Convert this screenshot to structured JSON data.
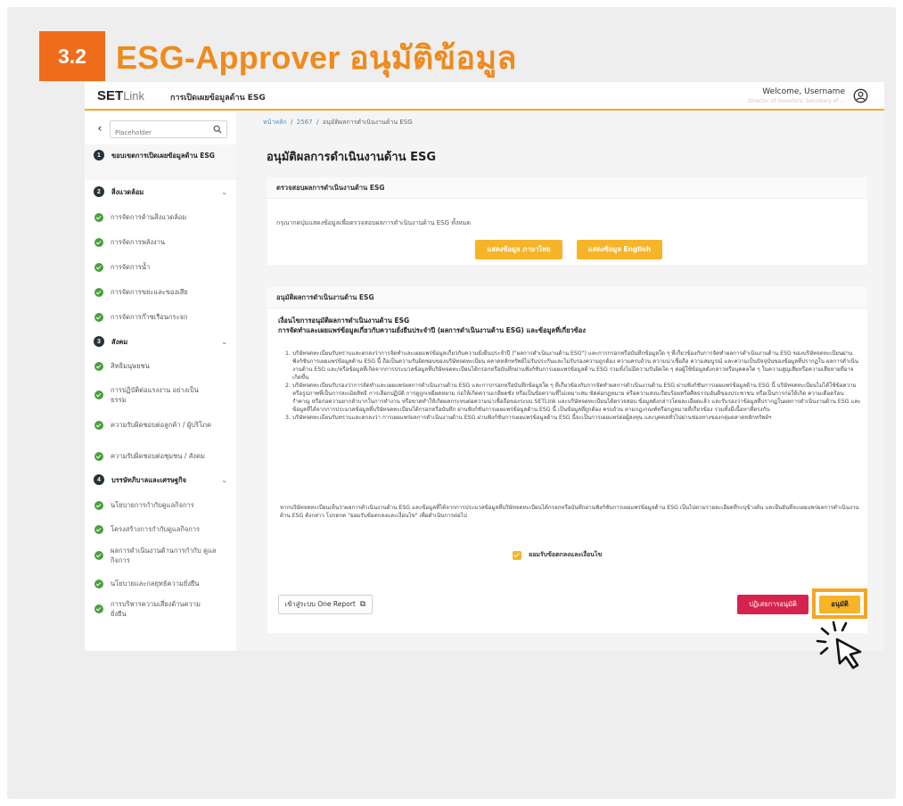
{
  "step": {
    "number": "3.2",
    "title": "ESG-Approver อนุมัติข้อมูล"
  },
  "header": {
    "logo_main": "SET",
    "logo_sub": "Link",
    "app_title": "การเปิดเผยข้อมูลด้าน ESG",
    "welcome": "Welcome, Username",
    "role": "Director of Investors, Secretary of ...",
    "user_icon": "user-circle-icon"
  },
  "sidebar": {
    "search_placeholder": "Placeholder",
    "items": [
      {
        "type": "section",
        "num": "1",
        "label": "ขอบเขตการเปิดเผยข้อมูลด้าน ESG"
      },
      {
        "type": "section",
        "num": "2",
        "label": "สิ่งแวดล้อม"
      },
      {
        "type": "item",
        "label": "การจัดการด้านสิ่งแวดล้อม"
      },
      {
        "type": "item",
        "label": "การจัดการพลังงาน"
      },
      {
        "type": "item",
        "label": "การจัดการน้ำ"
      },
      {
        "type": "item",
        "label": "การจัดการขยะและของเสีย"
      },
      {
        "type": "item",
        "label": "การจัดการก๊าซเรือนกระจก"
      },
      {
        "type": "section",
        "num": "3",
        "label": "สังคม"
      },
      {
        "type": "item",
        "label": "สิทธิมนุษยชน"
      },
      {
        "type": "item",
        "label": "การปฏิบัติต่อแรงงาน อย่างเป็นธรรม"
      },
      {
        "type": "item",
        "label": "ความรับผิดชอบต่อลูกค้า / ผู้บริโภค"
      },
      {
        "type": "item",
        "label": "ความรับผิดชอบต่อชุมชน / สังคม"
      },
      {
        "type": "section",
        "num": "4",
        "label": "บรรษัทภิบาลและเศรษฐกิจ"
      },
      {
        "type": "item",
        "label": "นโยบายการกำกับดูแลกิจการ"
      },
      {
        "type": "item",
        "label": "โครงสร้างการกำกับดูแลกิจการ"
      },
      {
        "type": "item",
        "label": "ผลการดำเนินงานด้านการกำกับ ดูแลกิจการ"
      },
      {
        "type": "item",
        "label": "นโยบายและกลยุทธ์ความยั่งยืน"
      },
      {
        "type": "item",
        "label": "การบริหารความเสี่ยงด้านความ ยั่งยืน"
      }
    ]
  },
  "breadcrumb": {
    "home": "หน้าหลัก",
    "year": "2567",
    "current": "อนุมัติผลการดำเนินงานด้าน ESG",
    "sep": "/"
  },
  "page_title": "อนุมัติผลการดำเนินงานด้าน ESG",
  "review": {
    "heading": "ตรวจสอบผลการดำเนินงานด้าน ESG",
    "description": "กรุณากดปุ่มแสดงข้อมูลเพื่อตรวจสอบผลการดำเนินงานด้าน ESG ทั้งหมด",
    "btn_thai": "แสดงข้อมูล ภาษาไทย",
    "btn_english": "แสดงข้อมูล English"
  },
  "approval": {
    "heading": "อนุมัติผลการดำเนินงานด้าน ESG",
    "cond_title": "เงื่อนไขการอนุมัติผลการดำเนินงานด้าน ESG",
    "cond_subtitle": "การจัดทำและเผยแพร่ข้อมูลเกี่ยวกับความยั่งยืนประจำปี (ผลการดำเนินงานด้าน ESG) และข้อมูลที่เกี่ยวข้อง",
    "terms": [
      {
        "n": "1.",
        "text": "บริษัทจดทะเบียนรับทราบและตกลงว่าการจัดทำและเผยแพร่ข้อมูลเกี่ยวกับความยั่งยืนประจำปี (\"ผลการดำเนินงานด้าน ESG\") และการกรอกหรือบันทึกข้อมูลใด ๆ ที่เกี่ยวข้องกับการจัดทำผลการดำเนินงานด้าน ESG ของบริษัทจดทะเบียนผ่านฟังก์ชันการเผยแพร่ข้อมูลด้าน ESG นี้ ถือเป็นความรับผิดชอบของบริษัทจดทะเบียน ตลาดหลักทรัพย์ไม่รับประกันและไม่รับรองความถูกต้อง ความครบถ้วน ความน่าเชื่อถือ ความสมบูรณ์ และความเป็นปัจจุบันของข้อมูลที่ปรากฏใน ผลการดำเนินงานด้าน ESG และ/หรือข้อมูลที่เกิดจากการประมวลข้อมูลที่บริษัทจดทะเบียนได้กรอกหรือบันทึกผ่านฟังก์ชันการเผยแพร่ข้อมูลด้าน ESG รวมทั้งไม่มีความรับผิดใด ๆ ต่อผู้ใช้ข้อมูลดังกล่าวหรือบุคคลใด ๆ ในความสูญเสียหรือความเสียหายที่อาจเกิดขึ้น"
      },
      {
        "n": "2.",
        "text": "บริษัทจดทะเบียนรับรองว่าการจัดทำและเผยแพร่ผลการดำเนินงานด้าน ESG และการกรอกหรือบันทึกข้อมูลใด ๆ ที่เกี่ยวข้องกับการจัดทำผลการดำเนินงานด้าน ESG ผ่านฟังก์ชันการเผยแพร่ข้อมูลด้าน ESG นี้ บริษัทจดทะเบียนไม่ได้ใช้ข้อความหรือรูปภาพที่เป็นการละเมิดสิทธิ การเลือกปฏิบัติ การดูถูกเหยียดหยาม ก่อให้เกิดความเกลียดชัง หรือเป็นข้อความที่ไม่เหมาะสม ขัดต่อกฎหมาย หรือความสงบเรียบร้อยหรือศีลธรรมอันดีของประชาชน หรือเป็นการก่อให้เกิด ความเดือดร้อนรำคาญ หรือก่อความยากลำบากในการทำงาน หรือขาดทำให้เกิดผลกระทบต่อความน่าเชื่อถือของระบบ SETLink และบริษัทจดทะเบียนได้ตรวจสอบ ข้อมูลดังกล่าวโดยละเอียดแล้ว และรับรองว่าข้อมูลที่ปรากฏในผลการดำเนินงานด้าน ESG และข้อมูลที่ได้จากการประมวลข้อมูลที่บริษัทจดทะเบียนได้กรอกหรือบันทึก ผ่านฟังก์ชันการเผยแพร่ข้อมูลด้าน ESG นี้ เป็นข้อมูลที่ถูกต้อง ครบถ้วน ตามกฎเกณฑ์หรือกฎหมายที่เกี่ยวข้อง รวมทั้งมีเนื้อหาที่ตรงกัน"
      },
      {
        "n": "3.",
        "text": "บริษัทจดทะเบียนรับทราบและตกลงว่า การเผยแพร่ผลการดำเนินงานด้าน ESG ผ่านฟังก์ชันการเผยแพร่ข้อมูลด้าน ESG นี้จะเป็นการเผยแพร่ต่อผู้ลงทุน และบุคคลทั่วไปผ่านช่องทางของกลุ่มตลาดหลักทรัพย์ฯ"
      }
    ],
    "note": "หากบริษัทจดทะเบียนเห็นว่าผลการดำเนินงานด้าน ESG และข้อมูลที่ได้จากการประมวลข้อมูลที่บริษัทจดทะเบียนได้กรอกหรือบันทึกผ่านฟังก์ชันการเผยแพร่ข้อมูลด้าน ESG เป็นไปตามรายละเอียดที่ระบุข้างต้น และยืนยันที่จะเผยแพร่ผลการดำเนินงานด้าน ESG ดังกล่าว โปรดกด \"ยอมรับข้อตกลงและเงื่อนไข\" เพื่อดำเนินการต่อไป",
    "consent_label": "ยอมรับข้อตกลงและเงื่อนไข",
    "consent_checked": true,
    "btn_one_report": "เข้าสู่ระบบ One Report",
    "btn_reject": "ปฏิเสธการอนุมัติ",
    "btn_approve": "อนุมัติ"
  },
  "colors": {
    "accent": "#f6b428",
    "badge": "#ef6c1a",
    "reject": "#d6234d",
    "check": "#49a03c"
  }
}
